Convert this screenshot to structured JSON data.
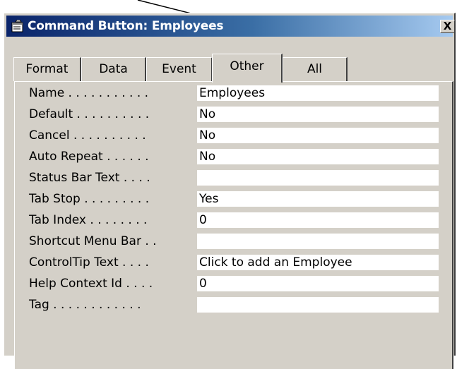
{
  "window": {
    "title": "Command Button: Employees",
    "close_label": "X"
  },
  "tabs": [
    {
      "label": "Format",
      "active": false
    },
    {
      "label": "Data",
      "active": false
    },
    {
      "label": "Event",
      "active": false
    },
    {
      "label": "Other",
      "active": true
    },
    {
      "label": "All",
      "active": false
    }
  ],
  "properties": [
    {
      "label": "Name . . . . . . . . . . .",
      "value": "Employees"
    },
    {
      "label": "Default . . . . . . . . . .",
      "value": "No"
    },
    {
      "label": "Cancel . . . . . . . . . .",
      "value": "No"
    },
    {
      "label": "Auto Repeat . . . . . .",
      "value": "No"
    },
    {
      "label": "Status Bar Text . . . .",
      "value": ""
    },
    {
      "label": "Tab Stop . . . . . . . . .",
      "value": "Yes"
    },
    {
      "label": "Tab Index . . . . . . . .",
      "value": "0"
    },
    {
      "label": "Shortcut Menu Bar . .",
      "value": ""
    },
    {
      "label": "ControlTip Text . . . .",
      "value": "Click to add an Employee"
    },
    {
      "label": "Help Context Id . . . .",
      "value": "0"
    },
    {
      "label": "Tag . . . . . . . . . . . .",
      "value": ""
    }
  ],
  "colors": {
    "title_bar_start": "#0a246a",
    "title_bar_end": "#a6caf0",
    "dialog_face": "#d4d0c8"
  },
  "icons": {
    "title": "properties-sheet-icon",
    "annotation": "pointer-arrow"
  }
}
